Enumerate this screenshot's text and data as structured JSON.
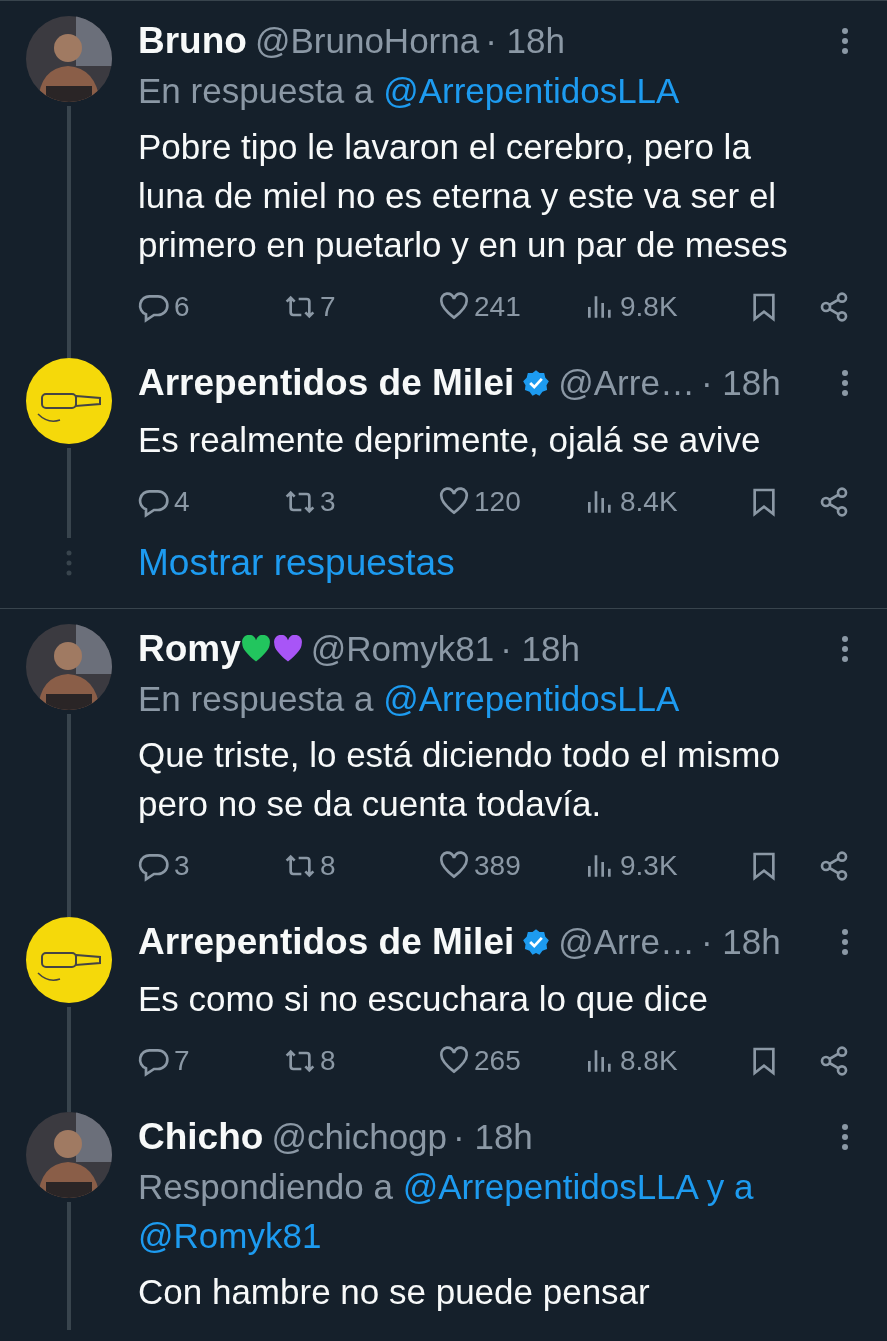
{
  "threads": [
    {
      "tweets": [
        {
          "avatar": {
            "kind": "person"
          },
          "name": "Bruno",
          "verified": false,
          "handle": "@BrunoHorna",
          "time": "· 18h",
          "reply": {
            "prefix": "En respuesta a",
            "links": [
              "@ArrepentidosLLA"
            ]
          },
          "text": "Pobre tipo le lavaron el cerebro, pero la luna de miel no es eterna y este va ser el primero en puetarlo y en un par de meses",
          "stats": {
            "replies": "6",
            "retweets": "7",
            "likes": "241",
            "views": "9.8K"
          },
          "connector": true
        },
        {
          "avatar": {
            "kind": "logo"
          },
          "name": "Arrepentidos de Milei",
          "verified": true,
          "handle": "@Arre…",
          "time": "· 18h",
          "text": "Es realmente deprimente, ojalá se avive",
          "stats": {
            "replies": "4",
            "retweets": "3",
            "likes": "120",
            "views": "8.4K"
          },
          "connector": true
        }
      ],
      "show_replies": "Mostrar respuestas"
    },
    {
      "tweets": [
        {
          "avatar": {
            "kind": "person"
          },
          "name": "Romy",
          "emoji": [
            {
              "color": "#22c55e"
            },
            {
              "color": "#a855f7"
            }
          ],
          "verified": false,
          "handle": "@Romyk81",
          "time": "· 18h",
          "reply": {
            "prefix": "En respuesta a",
            "links": [
              "@ArrepentidosLLA"
            ]
          },
          "text": "Que triste, lo está diciendo todo el mismo pero no se da cuenta todavía.",
          "stats": {
            "replies": "3",
            "retweets": "8",
            "likes": "389",
            "views": "9.3K"
          },
          "connector": true
        },
        {
          "avatar": {
            "kind": "logo"
          },
          "name": "Arrepentidos de Milei",
          "verified": true,
          "handle": "@Arre…",
          "time": "· 18h",
          "text": "Es como si no escuchara lo que dice",
          "stats": {
            "replies": "7",
            "retweets": "8",
            "likes": "265",
            "views": "8.8K"
          },
          "connector": true
        },
        {
          "avatar": {
            "kind": "person"
          },
          "name": "Chicho",
          "verified": false,
          "handle": "@chichogp",
          "time": "· 18h",
          "reply": {
            "prefix": "Respondiendo a",
            "links": [
              "@ArrepentidosLLA y a",
              "@Romyk81"
            ]
          },
          "text": "Con hambre no se puede pensar",
          "connector": true
        }
      ]
    }
  ]
}
